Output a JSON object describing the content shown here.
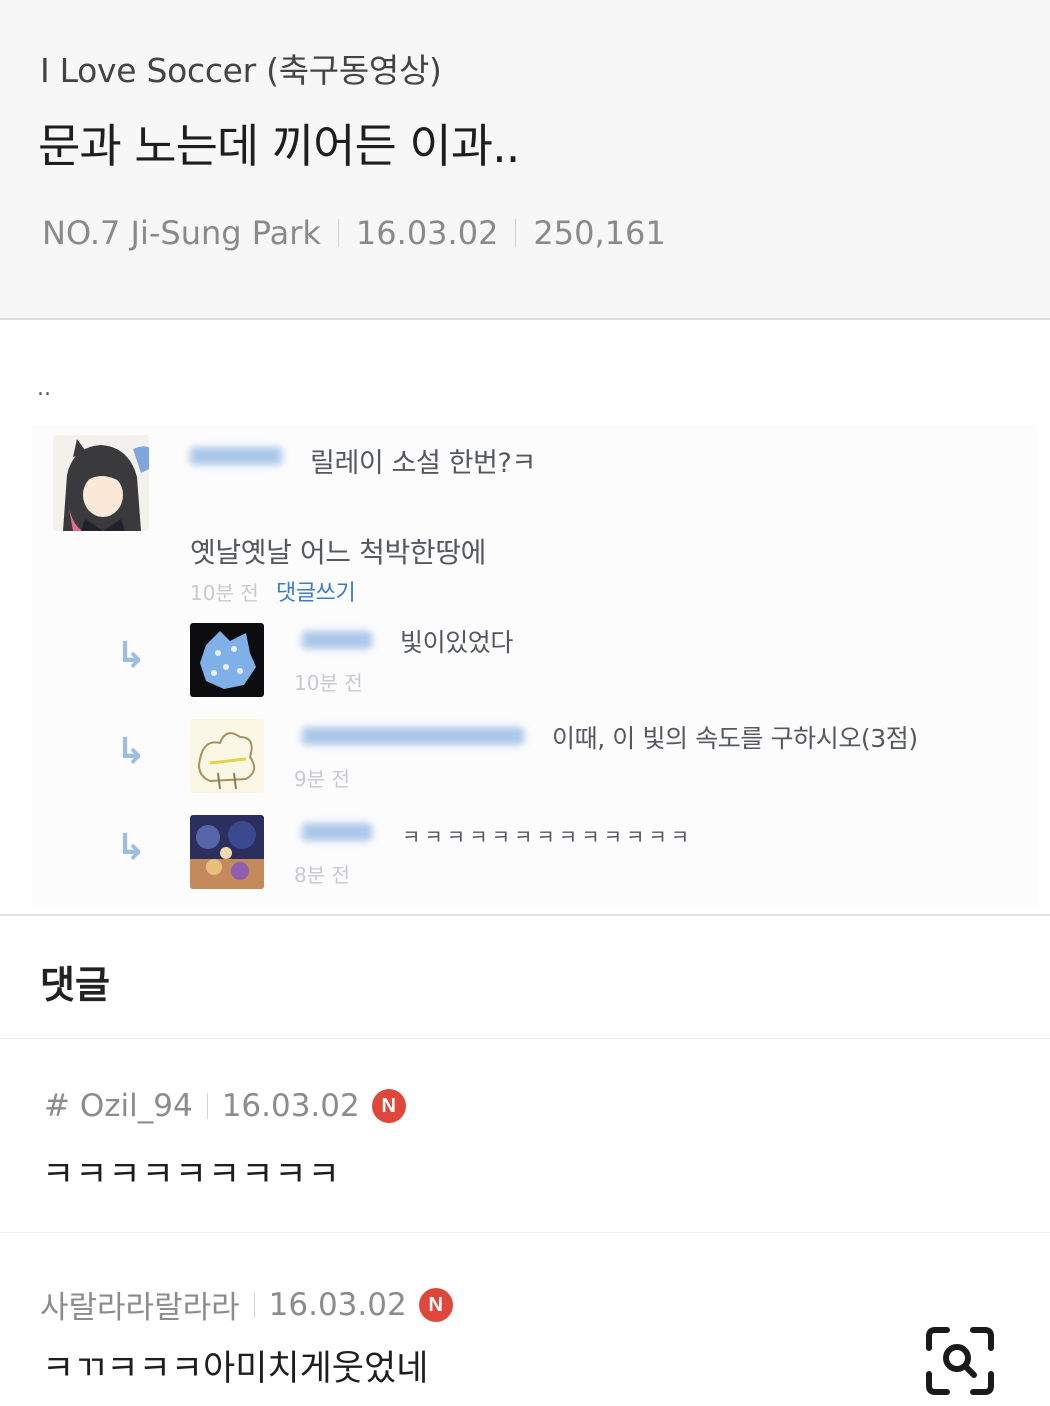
{
  "post": {
    "board_name": "I Love Soccer (축구동영상)",
    "title": "문과 노는데 끼어든 이과..",
    "author": "NO.7 Ji-Sung Park",
    "date": "16.03.02",
    "views": "250,161"
  },
  "body": {
    "intro": "..",
    "screenshot": {
      "main_comment": {
        "line1": "릴레이 소설 한번?ㅋ",
        "line2": "옛날옛날 어느 척박한땅에",
        "time": "10분 전",
        "reply_link": "댓글쓰기"
      },
      "replies": [
        {
          "text": "빛이있었다",
          "time": "10분 전"
        },
        {
          "text": "이때, 이 빛의 속도를 구하시오(3점)",
          "time": "9분 전"
        },
        {
          "text": "ㅋㅋㅋㅋㅋㅋㅋㅋㅋㅋㅋㅋㅋ",
          "time": "8분 전"
        }
      ]
    }
  },
  "comments_section": {
    "title": "댓글",
    "items": [
      {
        "author": "# Ozil_94",
        "date": "16.03.02",
        "badge": "N",
        "text": "ㅋㅋㅋㅋㅋㅋㅋㅋㅋ"
      },
      {
        "author": "사랄라라랄라라",
        "date": "16.03.02",
        "badge": "N",
        "text": "ㅋㄲㅋㅋㅋ아미치게웃었네"
      }
    ]
  },
  "colors": {
    "badge": "#e0473b",
    "reply_link": "#3b7dc4",
    "reply_arrow": "#9cbde0"
  },
  "icons": [
    "reply-arrow-icon",
    "new-badge-icon",
    "search-zoom-icon"
  ]
}
